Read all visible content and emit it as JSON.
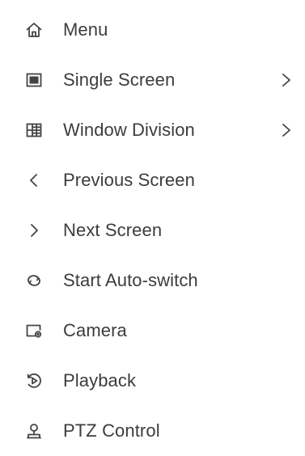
{
  "menu": {
    "items": [
      {
        "label": "Menu",
        "icon": "home-icon",
        "has_submenu": false
      },
      {
        "label": "Single Screen",
        "icon": "single-screen-icon",
        "has_submenu": true
      },
      {
        "label": "Window Division",
        "icon": "window-division-icon",
        "has_submenu": true
      },
      {
        "label": "Previous Screen",
        "icon": "chevron-left-icon",
        "has_submenu": false
      },
      {
        "label": "Next Screen",
        "icon": "chevron-right-icon",
        "has_submenu": false
      },
      {
        "label": "Start Auto-switch",
        "icon": "auto-switch-icon",
        "has_submenu": false
      },
      {
        "label": "Camera",
        "icon": "camera-icon",
        "has_submenu": false
      },
      {
        "label": "Playback",
        "icon": "playback-icon",
        "has_submenu": false
      },
      {
        "label": "PTZ Control",
        "icon": "ptz-control-icon",
        "has_submenu": false
      }
    ],
    "submenu_icon": "chevron-right-icon"
  },
  "colors": {
    "background": "#ffffff",
    "text": "#3c3c3c",
    "icon": "#444444"
  }
}
